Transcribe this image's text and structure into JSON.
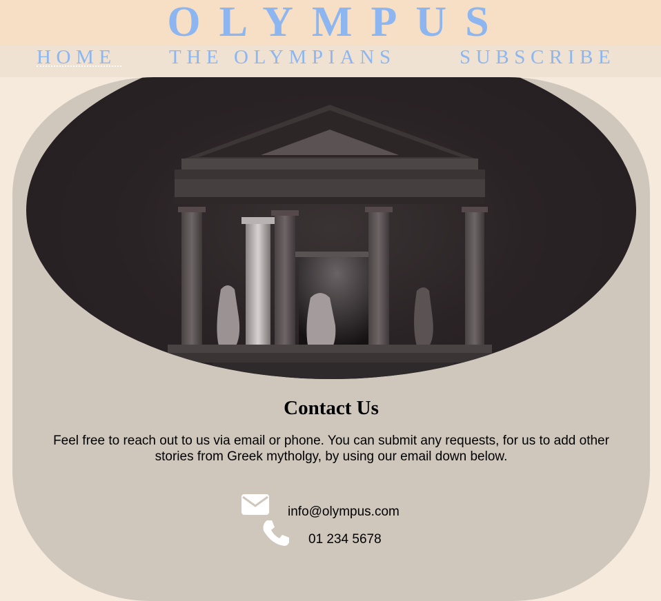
{
  "header": {
    "title": "OLYMPUS"
  },
  "nav": {
    "items": [
      {
        "label": "HOME"
      },
      {
        "label": "THE OLYMPIANS"
      },
      {
        "label": "SUBSCRIBE"
      }
    ],
    "active": "HOME"
  },
  "hero": {
    "image": "temple-night-photo"
  },
  "contact": {
    "heading": "Contact Us",
    "body": "Feel free to reach out to us via email or phone. You can submit any requests, for us to add other stories from Greek mytholgy, by using our email down below.",
    "email": "info@olympus.com",
    "phone": "01 234 5678",
    "email_icon": "envelope-icon",
    "phone_icon": "phone-icon"
  },
  "colors": {
    "accent": "#8db6f1",
    "header_bg": "#f6dfc4",
    "nav_bg": "#efe2d2",
    "page_bg": "#f6eadd",
    "card_bg": "#d0c7bc"
  }
}
